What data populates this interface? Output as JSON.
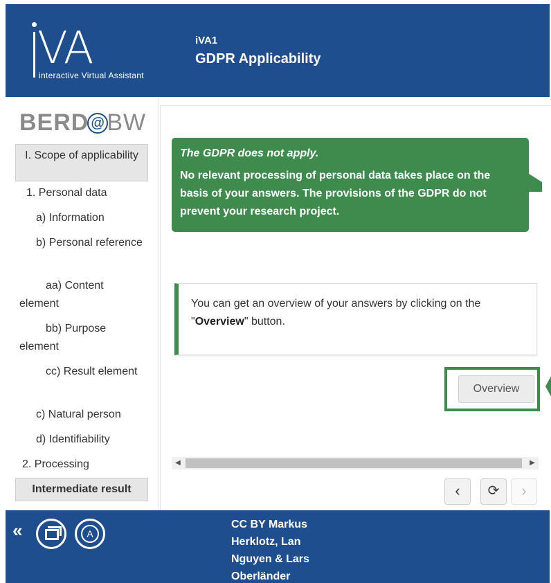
{
  "header": {
    "logo_text": "iVA",
    "logo_subtitle": "interactive Virtual Assistant",
    "app_code": "iVA1",
    "app_title": "GDPR Applicability"
  },
  "sidebar": {
    "brand": {
      "left": "BERD",
      "at": "@",
      "right": "BW"
    },
    "scope_button": "I. Scope of applicability",
    "items": [
      {
        "label": "1. Personal data"
      },
      {
        "label": "a) Information"
      },
      {
        "label": "b) Personal reference"
      },
      {
        "label": "aa) Content element"
      },
      {
        "label": "bb) Purpose element"
      },
      {
        "label": "cc) Result element"
      },
      {
        "label": "c) Natural person"
      },
      {
        "label": "d) Identifiability"
      },
      {
        "label": "2. Processing"
      }
    ],
    "intermediate_button": "Intermediate result"
  },
  "main": {
    "result": {
      "title": "The GDPR does not apply.",
      "text": "No relevant processing of personal data takes place on the basis of your answers. The provisions of the GDPR do not prevent your research project."
    },
    "info": {
      "text_before": "You can get an overview of your answers by clicking on the \"",
      "bold": "Overview",
      "text_after": "\" button."
    },
    "overview_button": "Overview",
    "nav": {
      "prev": "‹",
      "reload": "⟳",
      "next": "›"
    }
  },
  "footer": {
    "collapse": "«",
    "a_button": "A",
    "credit": "CC BY Markus Herklotz, Lan Nguyen & Lars Oberländer"
  },
  "colors": {
    "brand_blue": "#1f4e8f",
    "accent_green": "#3f8b4e"
  }
}
